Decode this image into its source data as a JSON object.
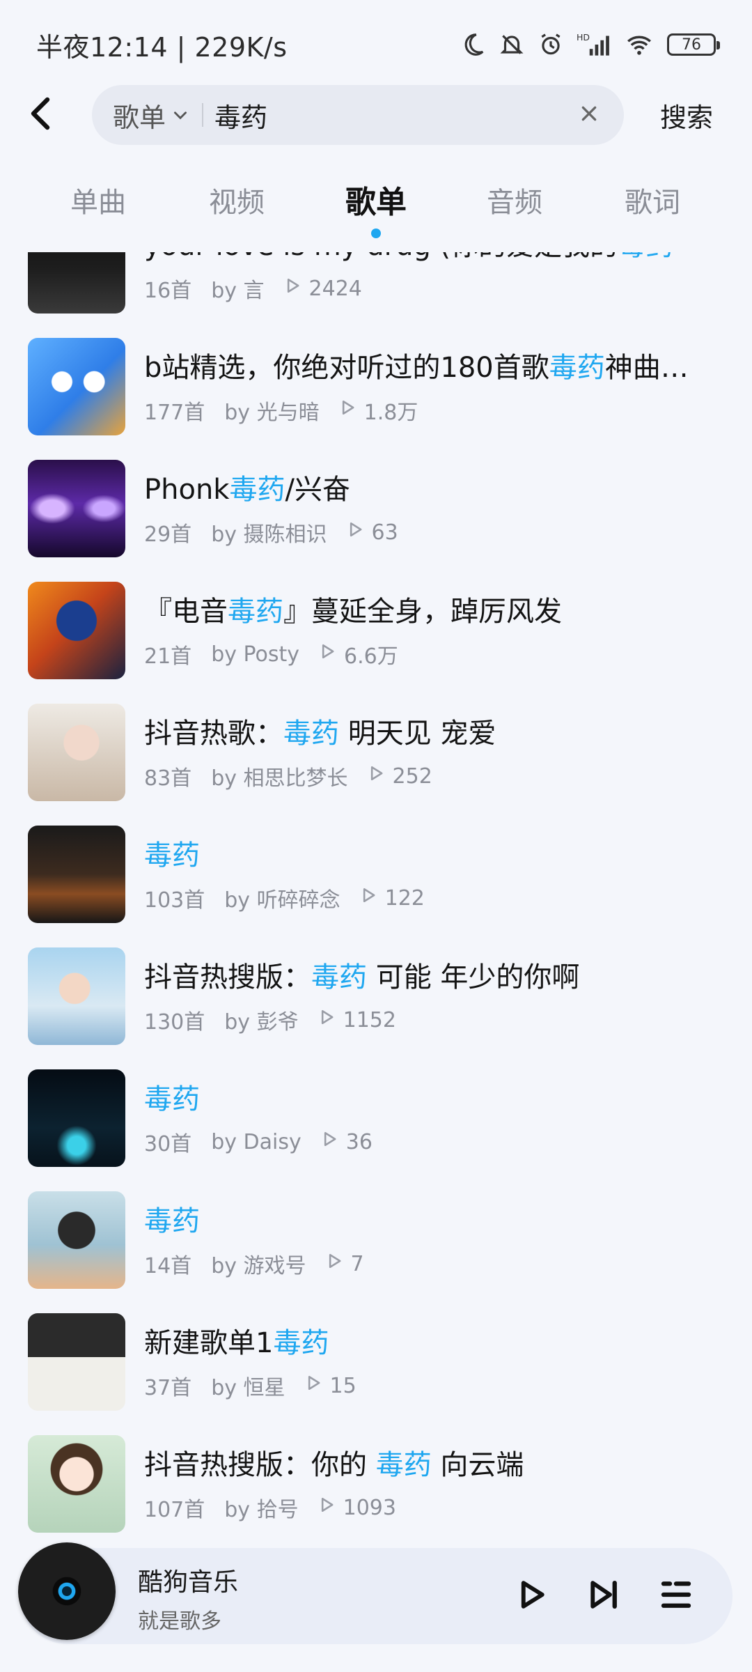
{
  "status_bar": {
    "time_text": "半夜12:14 | 229K/s",
    "battery": "76",
    "icons": [
      "moon-icon",
      "bell-mute-icon",
      "alarm-icon",
      "hd-signal-icon",
      "wifi-icon",
      "battery-icon"
    ]
  },
  "search": {
    "type_label": "歌单",
    "query": "毒药",
    "placeholder": "",
    "submit_label": "搜索"
  },
  "tabs": [
    {
      "label": "单曲",
      "active": false
    },
    {
      "label": "视频",
      "active": false
    },
    {
      "label": "歌单",
      "active": true
    },
    {
      "label": "音频",
      "active": false
    },
    {
      "label": "歌词",
      "active": false
    }
  ],
  "playlists": [
    {
      "title_before": "your love is my drug (你的爱是我的",
      "highlight": "毒药",
      "title_after": "",
      "count": "16首",
      "creator": "by 言",
      "plays": "2424"
    },
    {
      "title_before": "b站精选，你绝对听过的180首歌",
      "highlight": "毒药",
      "title_after": "神曲，…",
      "count": "177首",
      "creator": "by 光与暗",
      "plays": "1.8万"
    },
    {
      "title_before": "Phonk",
      "highlight": "毒药",
      "title_after": "/兴奋",
      "count": "29首",
      "creator": "by 摄陈相识",
      "plays": "63"
    },
    {
      "title_before": "『电音",
      "highlight": "毒药",
      "title_after": "』蔓延全身，踔厉风发",
      "count": "21首",
      "creator": "by Posty",
      "plays": "6.6万"
    },
    {
      "title_before": "抖音热歌：",
      "highlight": "毒药",
      "title_after": " 明天见 宠爱",
      "count": "83首",
      "creator": "by 相思比梦长",
      "plays": "252"
    },
    {
      "title_before": "",
      "highlight": "毒药",
      "title_after": "",
      "count": "103首",
      "creator": "by 听碎碎念",
      "plays": "122"
    },
    {
      "title_before": "抖音热搜版：",
      "highlight": "毒药",
      "title_after": " 可能 年少的你啊",
      "count": "130首",
      "creator": "by 彭爷",
      "plays": "1152"
    },
    {
      "title_before": "",
      "highlight": "毒药",
      "title_after": "",
      "count": "30首",
      "creator": "by Daisy",
      "plays": "36"
    },
    {
      "title_before": "",
      "highlight": "毒药",
      "title_after": "",
      "count": "14首",
      "creator": "by 游戏号",
      "plays": "7"
    },
    {
      "title_before": "新建歌单1",
      "highlight": "毒药",
      "title_after": "",
      "count": "37首",
      "creator": "by 恒星",
      "plays": "15"
    },
    {
      "title_before": "抖音热搜版：你的 ",
      "highlight": "毒药",
      "title_after": " 向云端",
      "count": "107首",
      "creator": "by 拾号",
      "plays": "1093"
    }
  ],
  "player": {
    "title": "酷狗音乐",
    "subtitle": "就是歌多"
  },
  "colors": {
    "accent": "#1fa7f0",
    "background": "#f4f6fb",
    "muted_text": "#8b8e97"
  }
}
